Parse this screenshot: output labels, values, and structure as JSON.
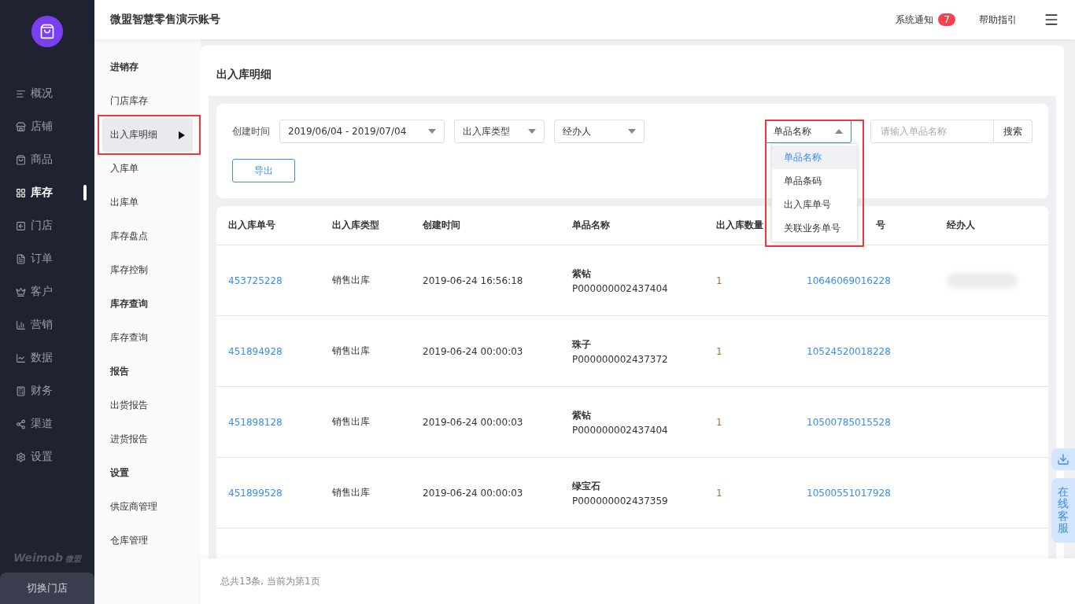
{
  "app": {
    "logo_text": "Weimob",
    "logo_sub": "微盟",
    "switch_store": "切换门店"
  },
  "nav": [
    {
      "label": "概况",
      "selected": false
    },
    {
      "label": "店铺",
      "selected": false
    },
    {
      "label": "商品",
      "selected": false
    },
    {
      "label": "库存",
      "selected": true
    },
    {
      "label": "门店",
      "selected": false
    },
    {
      "label": "订单",
      "selected": false
    },
    {
      "label": "客户",
      "selected": false
    },
    {
      "label": "营销",
      "selected": false
    },
    {
      "label": "数据",
      "selected": false
    },
    {
      "label": "财务",
      "selected": false
    },
    {
      "label": "渠道",
      "selected": false
    },
    {
      "label": "设置",
      "selected": false
    }
  ],
  "header": {
    "title": "微盟智慧零售演示账号",
    "notice": "系统通知",
    "notice_count": "7",
    "help": "帮助指引"
  },
  "subnav": [
    {
      "kind": "group",
      "label": "进销存"
    },
    {
      "kind": "item",
      "label": "门店库存",
      "selected": false
    },
    {
      "kind": "item",
      "label": "出入库明细",
      "selected": true
    },
    {
      "kind": "item",
      "label": "入库单",
      "selected": false
    },
    {
      "kind": "item",
      "label": "出库单",
      "selected": false
    },
    {
      "kind": "item",
      "label": "库存盘点",
      "selected": false
    },
    {
      "kind": "item",
      "label": "库存控制",
      "selected": false
    },
    {
      "kind": "group",
      "label": "库存查询"
    },
    {
      "kind": "item",
      "label": "库存查询",
      "selected": false
    },
    {
      "kind": "group",
      "label": "报告"
    },
    {
      "kind": "item",
      "label": "出货报告",
      "selected": false
    },
    {
      "kind": "item",
      "label": "进货报告",
      "selected": false
    },
    {
      "kind": "group",
      "label": "设置"
    },
    {
      "kind": "item",
      "label": "供应商管理",
      "selected": false
    },
    {
      "kind": "item",
      "label": "仓库管理",
      "selected": false
    }
  ],
  "page_title": "出入库明细",
  "filters": {
    "date_label": "创建时间",
    "date_range": "2019/06/04 - 2019/07/04",
    "type_select": "出入库类型",
    "operator_select": "经办人",
    "search_by": "单品名称",
    "search_by_expanded": true,
    "search_placeholder": "请输入单品名称",
    "search_button": "搜索",
    "export_button": "导出"
  },
  "search_by_options": [
    {
      "label": "单品名称",
      "selected": true
    },
    {
      "label": "单品条码",
      "selected": false
    },
    {
      "label": "出入库单号",
      "selected": false
    },
    {
      "label": "关联业务单号",
      "selected": false
    }
  ],
  "table": {
    "columns": [
      "出入库单号",
      "出入库类型",
      "创建时间",
      "单品名称",
      "出入库数量",
      "号",
      "经办人"
    ],
    "rows": [
      {
        "id": "453725228",
        "type": "销售出库",
        "created": "2019-06-24 16:56:18",
        "product": "紫钻",
        "code": "P000000002437404",
        "qty": "1",
        "related": "10646069016228",
        "operator_blurred": true
      },
      {
        "id": "451894928",
        "type": "销售出库",
        "created": "2019-06-24 00:00:03",
        "product": "珠子",
        "code": "P000000002437372",
        "qty": "1",
        "related": "10524520018228",
        "operator_blurred": false
      },
      {
        "id": "451898128",
        "type": "销售出库",
        "created": "2019-06-24 00:00:03",
        "product": "紫钻",
        "code": "P000000002437404",
        "qty": "1",
        "related": "10500785015528",
        "operator_blurred": false
      },
      {
        "id": "451899528",
        "type": "销售出库",
        "created": "2019-06-24 00:00:03",
        "product": "绿宝石",
        "code": "P000000002437359",
        "qty": "1",
        "related": "10500551017928",
        "operator_blurred": false
      }
    ]
  },
  "footer": "总共13条, 当前为第1页",
  "service": "在线客服"
}
